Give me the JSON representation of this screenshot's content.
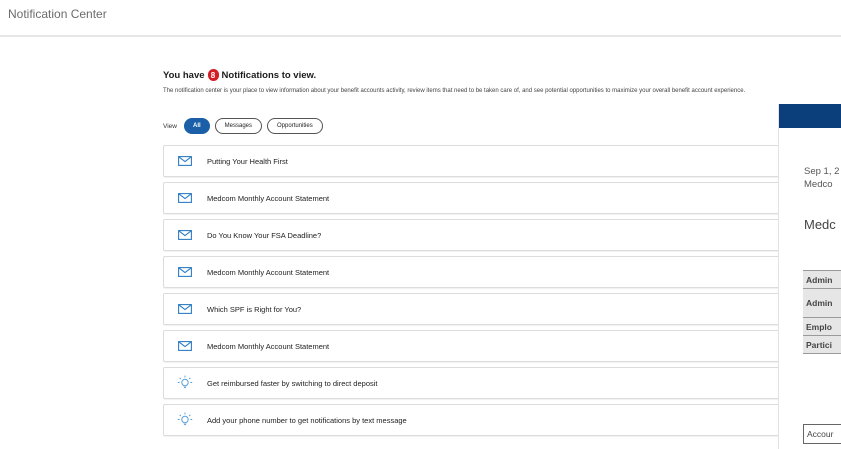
{
  "page": {
    "title": "Notification Center"
  },
  "heading": {
    "prefix": "You have",
    "count": "8",
    "suffix": "Notifications to view."
  },
  "description": "The notification center is your place to view information about your benefit accounts activity, review items that need to be taken care of, and see potential opportunities to maximize your overall benefit account experience.",
  "view": {
    "label": "View",
    "filters": [
      {
        "label": "All",
        "active": true
      },
      {
        "label": "Messages",
        "active": false
      },
      {
        "label": "Opportunities",
        "active": false
      }
    ]
  },
  "notifications": [
    {
      "icon": "envelope-icon",
      "label": "Putting Your Health First"
    },
    {
      "icon": "envelope-icon",
      "label": "Medcom Monthly Account Statement"
    },
    {
      "icon": "envelope-icon",
      "label": "Do You Know Your FSA Deadline?"
    },
    {
      "icon": "envelope-icon",
      "label": "Medcom Monthly Account Statement"
    },
    {
      "icon": "envelope-icon",
      "label": "Which SPF is Right for You?"
    },
    {
      "icon": "envelope-icon",
      "label": "Medcom Monthly Account Statement"
    },
    {
      "icon": "lightbulb-icon",
      "label": "Get reimbursed faster by switching to direct deposit"
    },
    {
      "icon": "lightbulb-icon",
      "label": "Add your phone number to get notifications by text message"
    }
  ],
  "detail_panel": {
    "date": "Sep 1, 2",
    "sender": "Medco",
    "title": "Medc",
    "table_rows": [
      "Admin",
      "Admin",
      "Emplo",
      "Partici"
    ],
    "account_label": "Accour"
  },
  "colors": {
    "accent": "#1a5fa8",
    "badge": "#d21f26",
    "panel_bar": "#0b3f7c",
    "icon": "#2e7cc4",
    "bulb": "#5aa0d8"
  }
}
